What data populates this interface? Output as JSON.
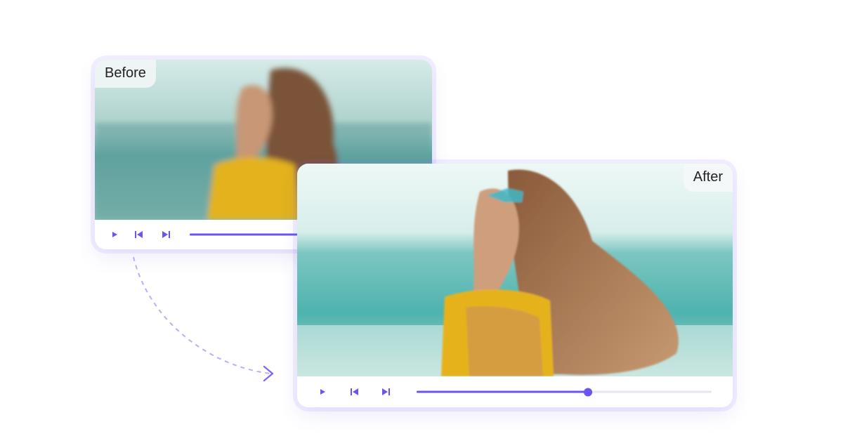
{
  "before": {
    "label": "Before",
    "progress": 0.5
  },
  "after": {
    "label": "After",
    "progress": 0.58
  },
  "controls": {
    "play_icon": "play-icon",
    "prev_icon": "skip-back-icon",
    "next_icon": "skip-forward-icon"
  },
  "colors": {
    "accent": "#6b55f0",
    "track": "#e6e6ee"
  }
}
